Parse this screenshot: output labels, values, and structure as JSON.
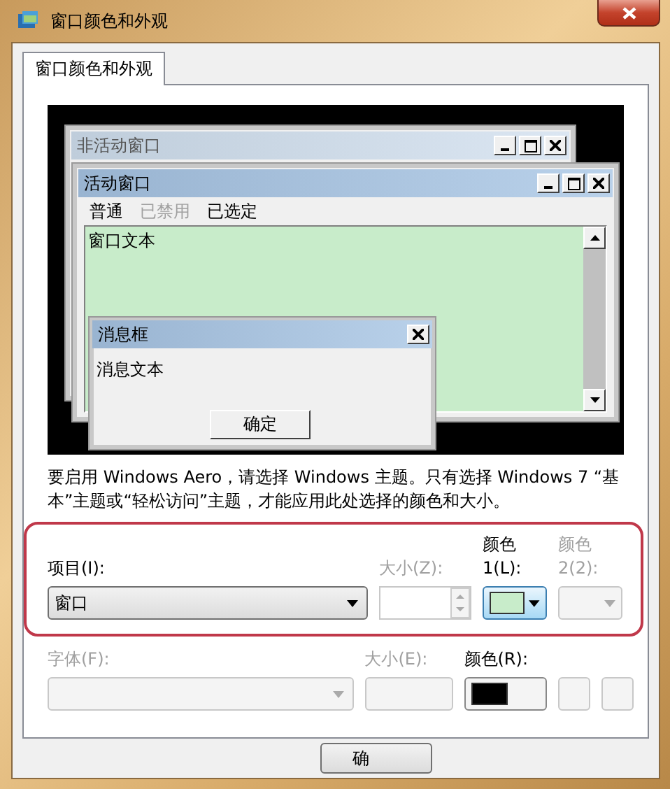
{
  "window": {
    "title": "窗口颜色和外观"
  },
  "tabs": [
    {
      "label": "窗口颜色和外观",
      "selected": true
    }
  ],
  "preview": {
    "inactive_window": {
      "title": "非活动窗口"
    },
    "active_window": {
      "title": "活动窗口",
      "menu": [
        {
          "label": "普通",
          "disabled": false
        },
        {
          "label": "已禁用",
          "disabled": true
        },
        {
          "label": "已选定",
          "disabled": false
        }
      ],
      "window_text": "窗口文本"
    },
    "message_box": {
      "title": "消息框",
      "text": "消息文本",
      "button": "确定"
    }
  },
  "notice": "要启用 Windows Aero，请选择 Windows 主题。只有选择 Windows 7 “基本”主题或“轻松访问”主题，才能应用此处选择的颜色和大小。",
  "item_row": {
    "item": {
      "label": "项目(I):",
      "value": "窗口",
      "disabled": false
    },
    "size": {
      "label": "大小(Z):",
      "disabled": true
    },
    "color1": {
      "label": "颜色 1(L):",
      "disabled": false,
      "color": "#c8ecca"
    },
    "color2": {
      "label": "颜色 2(2):",
      "disabled": true
    }
  },
  "font_row": {
    "font": {
      "label": "字体(F):",
      "disabled": true
    },
    "size": {
      "label": "大小(E):",
      "disabled": true
    },
    "color": {
      "label": "颜色(R):",
      "disabled": false,
      "color": "#000000"
    }
  },
  "buttons": [
    {
      "label": "确"
    }
  ]
}
